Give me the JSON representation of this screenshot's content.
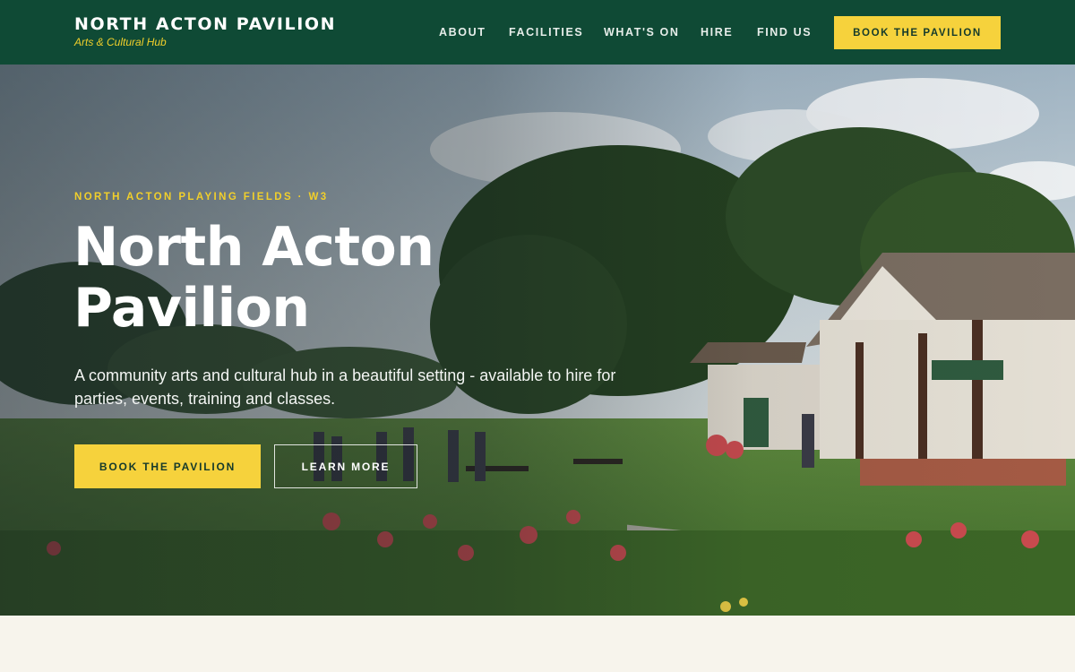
{
  "header": {
    "brand_title": "NORTH ACTON PAVILION",
    "brand_subtitle": "Arts & Cultural Hub",
    "nav": [
      {
        "label": "ABOUT"
      },
      {
        "label": "FACILITIES"
      },
      {
        "label": "WHAT'S ON"
      },
      {
        "label": "HIRE"
      },
      {
        "label": "FIND US"
      }
    ],
    "cta_label": "BOOK THE PAVILION"
  },
  "hero": {
    "eyebrow": "NORTH ACTON PLAYING FIELDS · W3",
    "title_line1": "North Acton",
    "title_line2": "Pavilion",
    "lead": "A community arts and cultural hub in a beautiful setting - available to hire for parties, events, training and classes.",
    "primary_label": "BOOK THE PAVILION",
    "secondary_label": "LEARN MORE"
  },
  "colors": {
    "header_bg": "#0f4a35",
    "accent": "#f6d23c",
    "page_bg": "#f7f4ec"
  }
}
